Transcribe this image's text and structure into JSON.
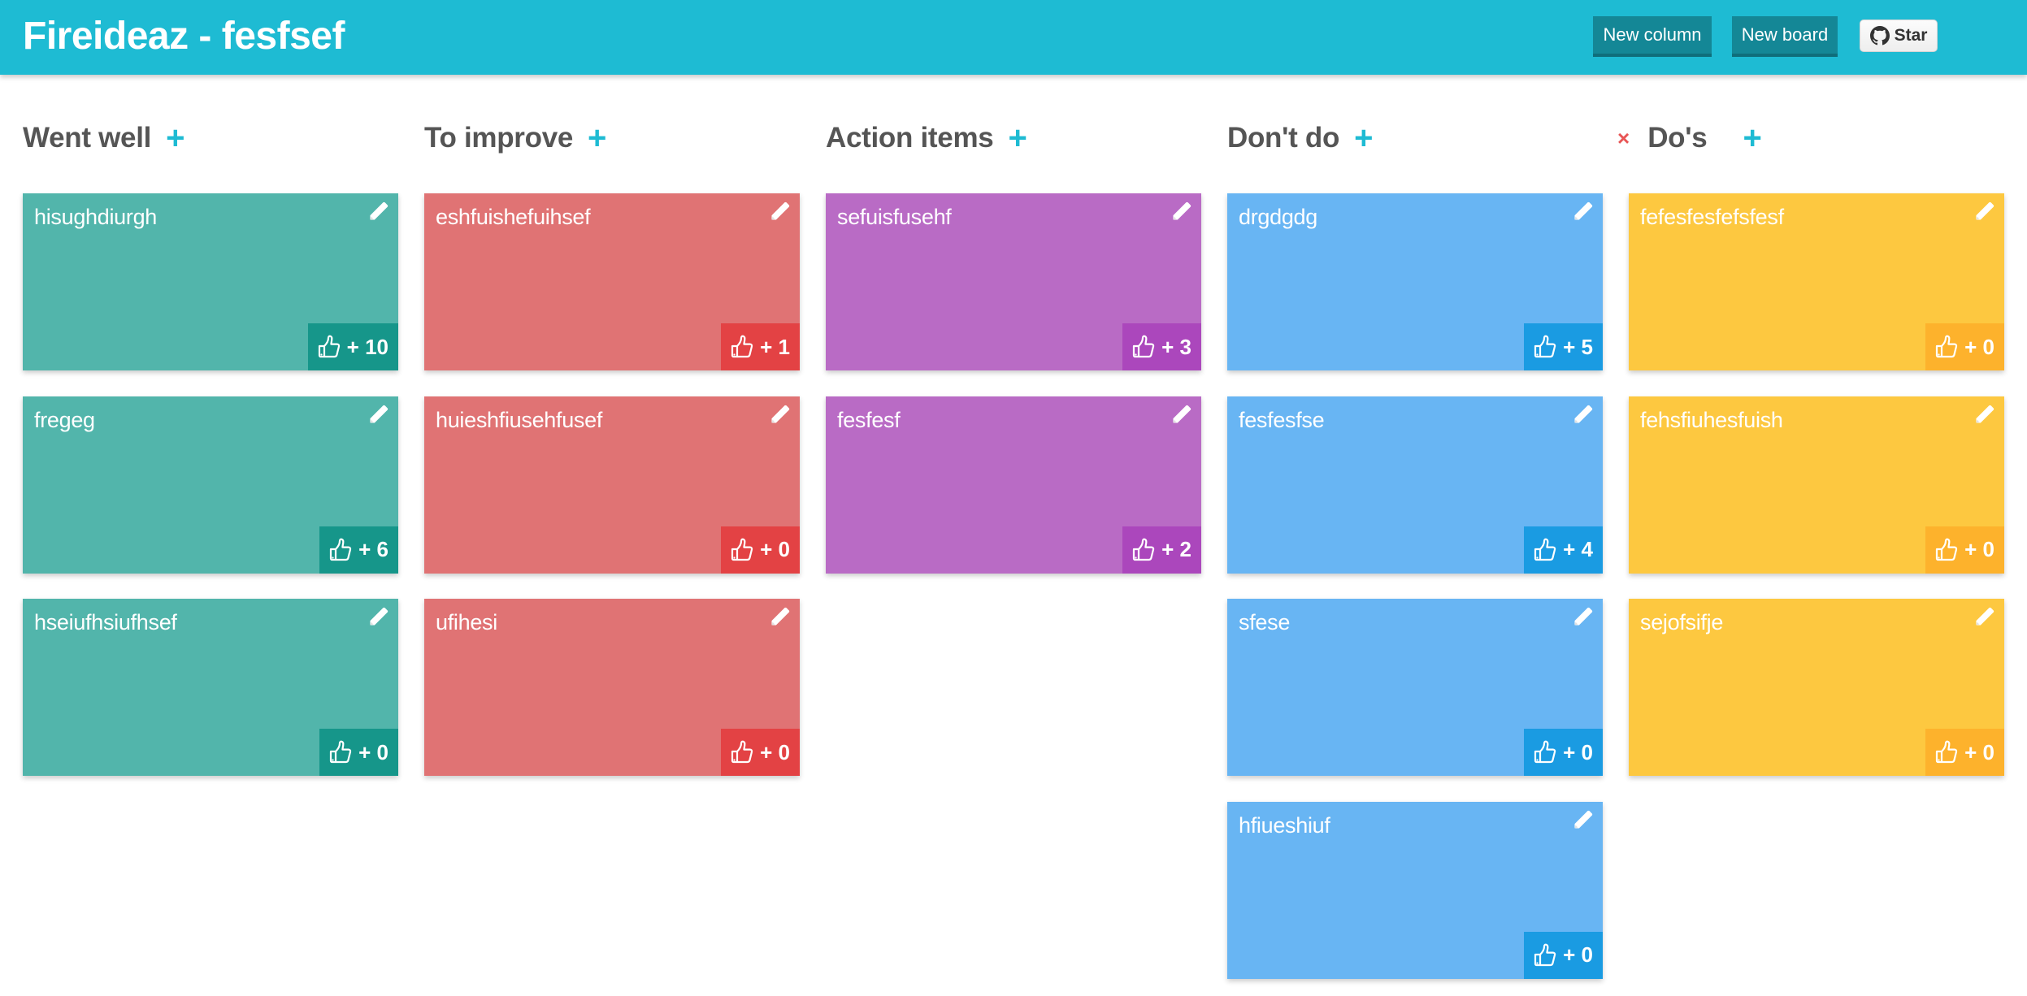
{
  "header": {
    "title": "Fireideaz - fesfsef",
    "new_column_label": "New column",
    "new_board_label": "New board",
    "star_label": "Star",
    "star_icon": "github-icon",
    "color": "#1ebbd3"
  },
  "columns": [
    {
      "title": "Went well",
      "removable": false,
      "card_color": "#52b5ab",
      "vote_color": "#16968a",
      "cards": [
        {
          "text": "hisughdiurgh",
          "votes": "+ 10"
        },
        {
          "text": "fregeg",
          "votes": "+ 6"
        },
        {
          "text": "hseiufhsiufhsef",
          "votes": "+ 0"
        }
      ]
    },
    {
      "title": "To improve",
      "removable": false,
      "card_color": "#e07374",
      "vote_color": "#e34244",
      "cards": [
        {
          "text": "eshfuishefuihsef",
          "votes": "+ 1"
        },
        {
          "text": "huieshfiusehfusef",
          "votes": "+ 0"
        },
        {
          "text": "ufihesi",
          "votes": "+ 0"
        }
      ]
    },
    {
      "title": "Action items",
      "removable": false,
      "card_color": "#b96bc5",
      "vote_color": "#ab47bc",
      "cards": [
        {
          "text": "sefuisfusehf",
          "votes": "+ 3"
        },
        {
          "text": "fesfesf",
          "votes": "+ 2"
        }
      ]
    },
    {
      "title": "Don't do",
      "removable": false,
      "card_color": "#68b5f3",
      "vote_color": "#1a9be2",
      "cards": [
        {
          "text": "drgdgdg",
          "votes": "+ 5"
        },
        {
          "text": "fesfesfse",
          "votes": "+ 4"
        },
        {
          "text": "sfese",
          "votes": "+ 0"
        },
        {
          "text": "hfiueshiuf",
          "votes": "+ 0"
        }
      ]
    },
    {
      "title": "Do's",
      "removable": true,
      "remove_icon": "×",
      "card_color": "#fdc840",
      "vote_color": "#fdb22c",
      "cards": [
        {
          "text": "fefesfesfefsfesf",
          "votes": "+ 0"
        },
        {
          "text": "fehsfiuhesfuish",
          "votes": "+ 0"
        },
        {
          "text": "sejofsifje",
          "votes": "+ 0"
        }
      ]
    }
  ],
  "icons": {
    "add": "+",
    "edit": "pencil-icon",
    "vote": "thumbs-up-icon"
  }
}
